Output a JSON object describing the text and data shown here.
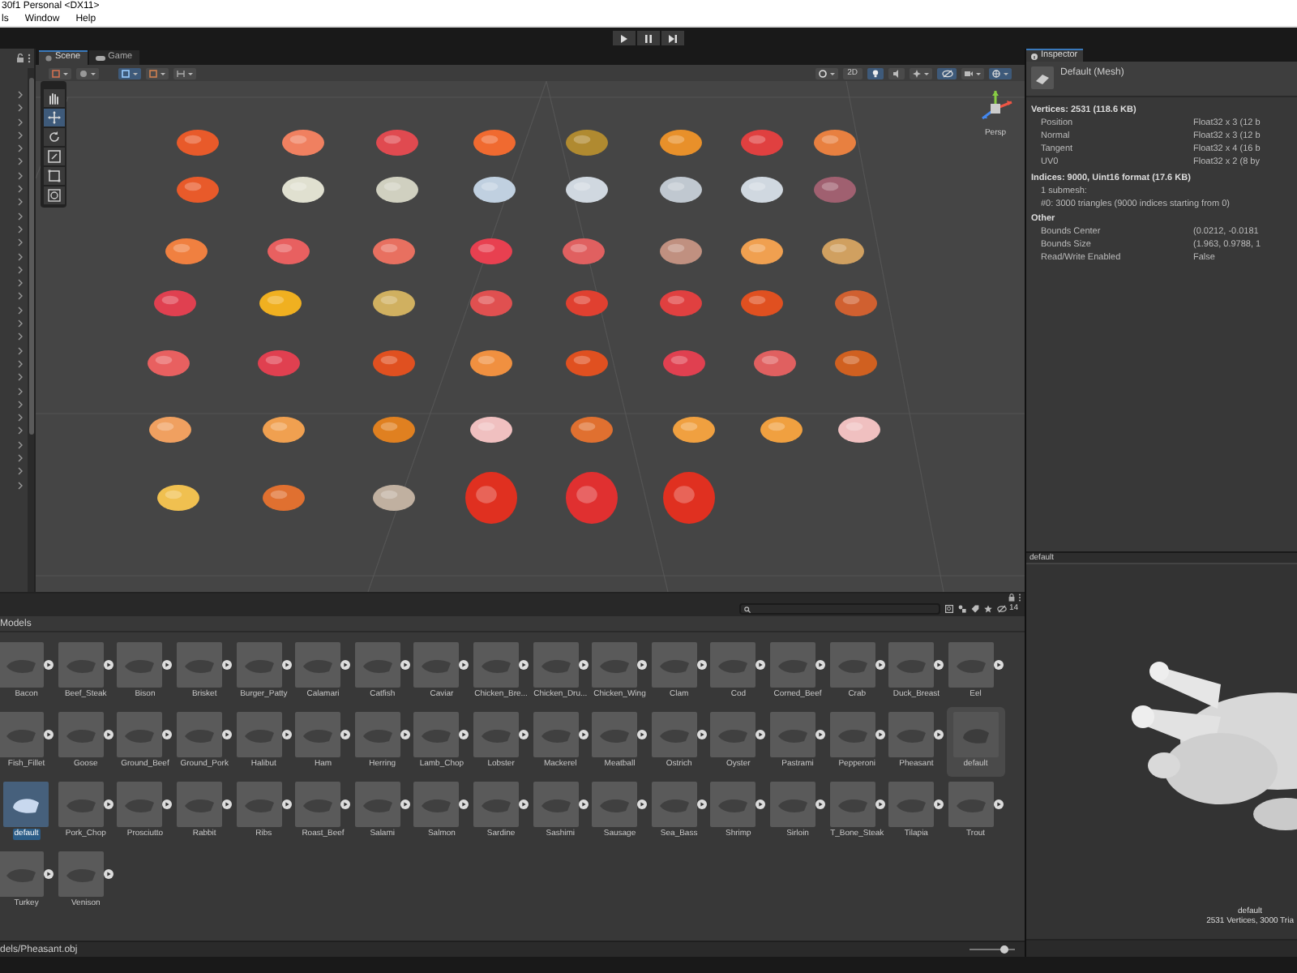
{
  "window": {
    "title": "30f1 Personal <DX11>"
  },
  "menu": [
    "ls",
    "Window",
    "Help"
  ],
  "playbar": [
    {
      "kind": "play"
    },
    {
      "kind": "pause"
    },
    {
      "kind": "step"
    }
  ],
  "scene_view": {
    "tabs": [
      {
        "label": "Scene",
        "kind": "scene",
        "selected": true
      },
      {
        "label": "Game",
        "kind": "game",
        "selected": false
      }
    ],
    "toggle_2d": "2D",
    "gizmo_label": "Persp",
    "toggles": {
      "grid": true,
      "lighting": true,
      "audio": false,
      "visibility": true,
      "gizmos": true
    },
    "tools": [
      {
        "kind": "hand",
        "selected": false
      },
      {
        "kind": "move",
        "selected": true
      },
      {
        "kind": "rotate",
        "selected": false
      },
      {
        "kind": "scale",
        "selected": false
      },
      {
        "kind": "rect",
        "selected": false
      },
      {
        "kind": "transform",
        "selected": false
      }
    ]
  },
  "inspector": {
    "tab": "Inspector",
    "header": "Default (Mesh)",
    "sections": [
      {
        "title": "Vertices: 2531 (118.6 KB)",
        "rows": [
          {
            "label": "Position",
            "value": "Float32 x 3 (12 b"
          },
          {
            "label": "Normal",
            "value": "Float32 x 3 (12 b"
          },
          {
            "label": "Tangent",
            "value": "Float32 x 4 (16 b"
          },
          {
            "label": "UV0",
            "value": "Float32 x 2 (8 by"
          }
        ]
      },
      {
        "title": "Indices: 9000, Uint16 format (17.6 KB)",
        "lines": [
          "1 submesh:",
          "#0: 3000 triangles (9000 indices starting from 0)"
        ]
      },
      {
        "title": "Other",
        "rows": [
          {
            "label": "Bounds Center",
            "value": "(0.0212, -0.0181"
          },
          {
            "label": "Bounds Size",
            "value": "(1.963, 0.9788, 1"
          },
          {
            "label": "Read/Write Enabled",
            "value": "False"
          }
        ]
      }
    ]
  },
  "preview": {
    "header": "default",
    "caption_name": "default",
    "caption_stats": "2531 Vertices, 3000 Tria"
  },
  "project": {
    "breadcrumb": "Models",
    "hidden_count": "14",
    "status_path": "dels/Pheasant.obj",
    "thumbnail_slider": {
      "level": 0.75
    },
    "assets": [
      {
        "name": "Bacon",
        "kind": "model",
        "selected": false
      },
      {
        "name": "Beef_Steak",
        "kind": "model",
        "selected": false
      },
      {
        "name": "Bison",
        "kind": "model",
        "selected": false
      },
      {
        "name": "Brisket",
        "kind": "model",
        "selected": false
      },
      {
        "name": "Burger_Patty",
        "kind": "model",
        "selected": false
      },
      {
        "name": "Calamari",
        "kind": "model",
        "selected": false
      },
      {
        "name": "Catfish",
        "kind": "model",
        "selected": false
      },
      {
        "name": "Caviar",
        "kind": "model",
        "selected": false
      },
      {
        "name": "Chicken_Bre...",
        "kind": "model",
        "selected": false
      },
      {
        "name": "Chicken_Dru...",
        "kind": "model",
        "selected": false
      },
      {
        "name": "Chicken_Wing",
        "kind": "model",
        "selected": false
      },
      {
        "name": "Clam",
        "kind": "model",
        "selected": false
      },
      {
        "name": "Cod",
        "kind": "model",
        "selected": false
      },
      {
        "name": "Corned_Beef",
        "kind": "model",
        "selected": false
      },
      {
        "name": "Crab",
        "kind": "model",
        "selected": false
      },
      {
        "name": "Duck_Breast",
        "kind": "model",
        "selected": false
      },
      {
        "name": "Eel",
        "kind": "model",
        "selected": false
      },
      {
        "name": "Fish_Fillet",
        "kind": "model",
        "selected": false
      },
      {
        "name": "Goose",
        "kind": "model",
        "selected": false
      },
      {
        "name": "Ground_Beef",
        "kind": "model",
        "selected": false
      },
      {
        "name": "Ground_Pork",
        "kind": "model",
        "selected": false
      },
      {
        "name": "Halibut",
        "kind": "model",
        "selected": false
      },
      {
        "name": "Ham",
        "kind": "model",
        "selected": false
      },
      {
        "name": "Herring",
        "kind": "model",
        "selected": false
      },
      {
        "name": "Lamb_Chop",
        "kind": "model",
        "selected": false
      },
      {
        "name": "Lobster",
        "kind": "model",
        "selected": false
      },
      {
        "name": "Mackerel",
        "kind": "model",
        "selected": false
      },
      {
        "name": "Meatball",
        "kind": "model",
        "selected": false
      },
      {
        "name": "Ostrich",
        "kind": "model",
        "selected": false
      },
      {
        "name": "Oyster",
        "kind": "model",
        "selected": false
      },
      {
        "name": "Pastrami",
        "kind": "model",
        "selected": false
      },
      {
        "name": "Pepperoni",
        "kind": "model",
        "selected": false
      },
      {
        "name": "Pheasant",
        "kind": "model",
        "selected": false
      },
      {
        "name": "default",
        "kind": "submesh",
        "selected": false
      },
      {
        "name": "default",
        "kind": "submesh",
        "selected": true
      },
      {
        "name": "Pork_Chop",
        "kind": "model",
        "selected": false
      },
      {
        "name": "Prosciutto",
        "kind": "model",
        "selected": false
      },
      {
        "name": "Rabbit",
        "kind": "model",
        "selected": false
      },
      {
        "name": "Ribs",
        "kind": "model",
        "selected": false
      },
      {
        "name": "Roast_Beef",
        "kind": "model",
        "selected": false
      },
      {
        "name": "Salami",
        "kind": "model",
        "selected": false
      },
      {
        "name": "Salmon",
        "kind": "model",
        "selected": false
      },
      {
        "name": "Sardine",
        "kind": "model",
        "selected": false
      },
      {
        "name": "Sashimi",
        "kind": "model",
        "selected": false
      },
      {
        "name": "Sausage",
        "kind": "model",
        "selected": false
      },
      {
        "name": "Sea_Bass",
        "kind": "model",
        "selected": false
      },
      {
        "name": "Shrimp",
        "kind": "model",
        "selected": false
      },
      {
        "name": "Sirloin",
        "kind": "model",
        "selected": false
      },
      {
        "name": "T_Bone_Steak",
        "kind": "model",
        "selected": false
      },
      {
        "name": "Tilapia",
        "kind": "model",
        "selected": false
      },
      {
        "name": "Trout",
        "kind": "model",
        "selected": false
      },
      {
        "name": "Turkey",
        "kind": "model",
        "selected": false
      },
      {
        "name": "Venison",
        "kind": "model",
        "selected": false
      }
    ]
  }
}
